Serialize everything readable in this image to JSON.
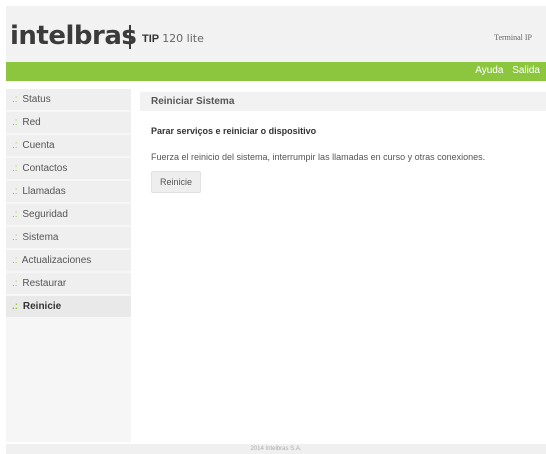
{
  "header": {
    "brand": "intelbras",
    "product_bold": "TIP",
    "product_model": "120 lite",
    "terminal_label": "Terminal IP"
  },
  "topbar": {
    "help_link": "Ayuda",
    "exit_link": "Salida"
  },
  "sidebar": {
    "items": [
      {
        "prefix": ".:",
        "label": "Status"
      },
      {
        "prefix": ".:",
        "label": "Red"
      },
      {
        "prefix": ".:",
        "label": "Cuenta"
      },
      {
        "prefix": ".:",
        "label": "Contactos"
      },
      {
        "prefix": ".:",
        "label": "Llamadas"
      },
      {
        "prefix": ".:",
        "label": "Seguridad"
      },
      {
        "prefix": ".:",
        "label": "Sistema"
      },
      {
        "prefix": ".:",
        "label": "Actualizaciones"
      },
      {
        "prefix": ".:",
        "label": "Restaurar"
      },
      {
        "prefix": ".:",
        "label": "Reinicie"
      }
    ],
    "active_item": "Reinicie"
  },
  "main": {
    "section_title": "Reiniciar Sistema",
    "subheading": "Parar serviços e reiniciar o dispositivo",
    "description": "Fuerza el reinicio del sistema, interrumpir las llamadas en curso y otras conexiones.",
    "restart_button": "Reinicie"
  },
  "footer": {
    "copyright": "2014 Intelbras S.A."
  },
  "colors": {
    "accent_green": "#8cc63f",
    "header_bg": "#f2f2f2",
    "sidebar_bg": "#f6f6f6"
  }
}
